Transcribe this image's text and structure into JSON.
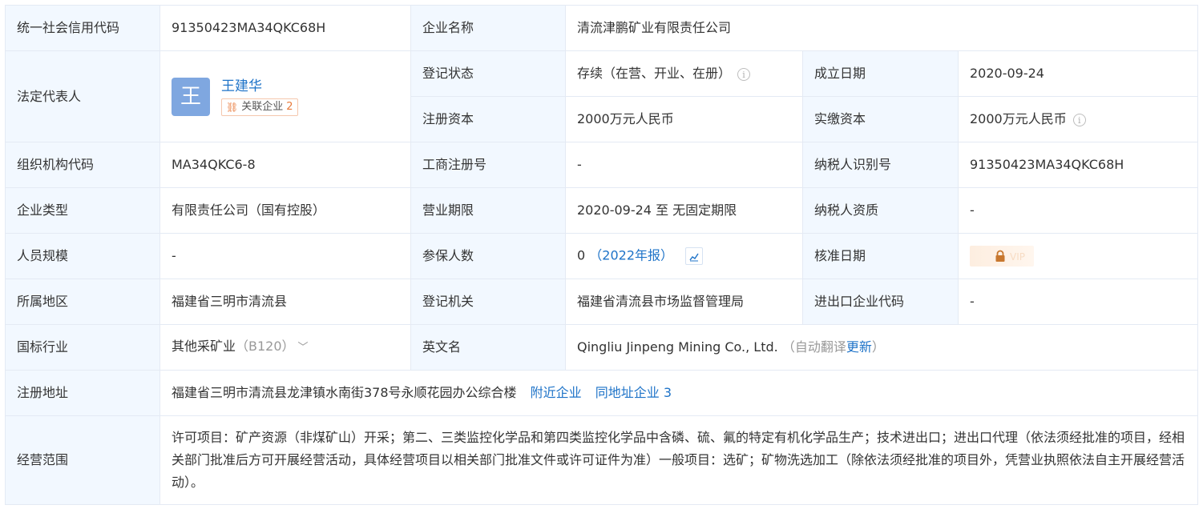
{
  "labels": {
    "credit_code": "统一社会信用代码",
    "company_name": "企业名称",
    "legal_rep": "法定代表人",
    "reg_status": "登记状态",
    "found_date": "成立日期",
    "reg_capital": "注册资本",
    "paid_capital": "实缴资本",
    "org_code": "组织机构代码",
    "biz_reg_no": "工商注册号",
    "taxpayer_id": "纳税人识别号",
    "company_type": "企业类型",
    "biz_term": "营业期限",
    "taxpayer_qual": "纳税人资质",
    "staff_size": "人员规模",
    "insured": "参保人数",
    "approve_date": "核准日期",
    "region": "所属地区",
    "reg_authority": "登记机关",
    "import_export_code": "进出口企业代码",
    "industry": "国标行业",
    "english_name": "英文名",
    "reg_address": "注册地址",
    "biz_scope": "经营范围"
  },
  "values": {
    "credit_code": "91350423MA34QKC68H",
    "company_name": "清流津鹏矿业有限责任公司",
    "legal_rep_avatar": "王",
    "legal_rep_name": "王建华",
    "legal_rep_related_label": "关联企业",
    "legal_rep_related_count": "2",
    "reg_status": "存续（在营、开业、在册）",
    "found_date": "2020-09-24",
    "reg_capital": "2000万元人民币",
    "paid_capital": "2000万元人民币",
    "org_code": "MA34QKC6-8",
    "biz_reg_no": "-",
    "taxpayer_id": "91350423MA34QKC68H",
    "company_type": "有限责任公司（国有控股）",
    "biz_term": "2020-09-24 至 无固定期限",
    "taxpayer_qual": "-",
    "staff_size": "-",
    "insured_count": "0",
    "insured_year": "（2022年报）",
    "approve_date_vip": "VIP",
    "region": "福建省三明市清流县",
    "reg_authority": "福建省清流县市场监督管理局",
    "import_export_code": "-",
    "industry_name": "其他采矿业",
    "industry_code": "（B120）",
    "english_name": "Qingliu Jinpeng Mining Co., Ltd.",
    "english_auto_prefix": "（自动翻译",
    "english_update": "更新",
    "english_auto_suffix": "）",
    "reg_address": "福建省三明市清流县龙津镇水南街378号永顺花园办公综合楼",
    "nearby_link": "附近企业",
    "same_address_link": "同地址企业",
    "same_address_count": "3",
    "biz_scope": "许可项目：矿产资源（非煤矿山）开采；第二、三类监控化学品和第四类监控化学品中含磷、硫、氟的特定有机化学品生产；技术进出口；进出口代理（依法须经批准的项目，经相关部门批准后方可开展经营活动，具体经营项目以相关部门批准文件或许可证件为准）一般项目：选矿；矿物洗选加工（除依法须经批准的项目外，凭营业执照依法自主开展经营活动）。"
  },
  "icons": {
    "info": "info-circle-icon",
    "related": "network-icon",
    "chart": "trend-chart-icon",
    "lock": "lock-icon",
    "chevron": "chevron-down-icon"
  },
  "colors": {
    "label_bg": "#f2f8ff",
    "border": "#e4eaf4",
    "link": "#1e73c8",
    "muted": "#999999",
    "avatar": "#7fa7e0",
    "accent": "#e8793a"
  }
}
